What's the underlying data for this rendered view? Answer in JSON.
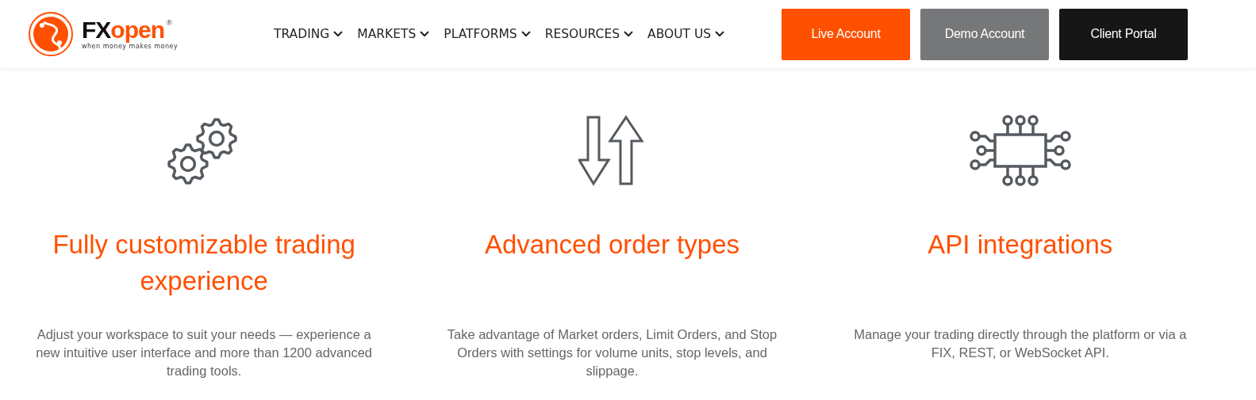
{
  "header": {
    "logo": {
      "brand_dark": "FX",
      "brand_accent": "open",
      "registered": "®",
      "tagline": "when money makes money"
    },
    "nav": [
      {
        "label": "TRADING"
      },
      {
        "label": "MARKETS"
      },
      {
        "label": "PLATFORMS"
      },
      {
        "label": "RESOURCES"
      },
      {
        "label": "ABOUT US"
      }
    ],
    "buttons": [
      {
        "label": "Live Account",
        "kind": "primary"
      },
      {
        "label": "Demo Account",
        "kind": "secondary"
      },
      {
        "label": "Client Portal",
        "kind": "dark"
      }
    ]
  },
  "features": [
    {
      "kind": "gears",
      "title": "Fully customizable trading experience",
      "description": "Adjust your workspace to suit your needs — experience a new intuitive user interface and more than 1200 advanced trading tools."
    },
    {
      "kind": "arrows",
      "title": "Advanced order types",
      "description": "Take advantage of Market orders, Limit Orders, and Stop Orders with settings for volume units, stop levels, and slippage."
    },
    {
      "kind": "chip",
      "title": "API integrations",
      "description": "Manage your trading directly through the platform or via a FIX, REST, or WebSocket API."
    }
  ]
}
